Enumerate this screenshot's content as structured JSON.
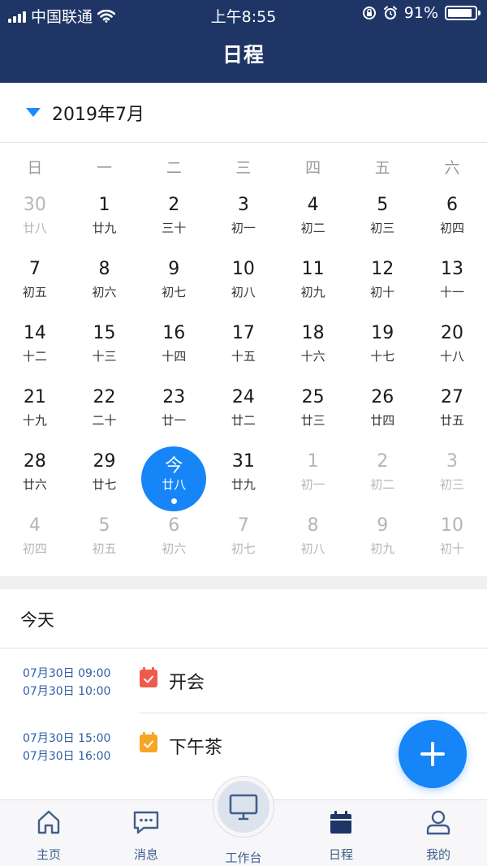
{
  "status_bar": {
    "carrier": "中国联通",
    "time": "上午8:55",
    "battery": "91%",
    "battery_level": 0.91
  },
  "header": {
    "title": "日程"
  },
  "month_selector": {
    "label": "2019年7月"
  },
  "calendar": {
    "weekdays": [
      "日",
      "一",
      "二",
      "三",
      "四",
      "五",
      "六"
    ],
    "weeks": [
      [
        {
          "day": "30",
          "lunar": "廿八",
          "dim": true
        },
        {
          "day": "1",
          "lunar": "廿九"
        },
        {
          "day": "2",
          "lunar": "三十"
        },
        {
          "day": "3",
          "lunar": "初一"
        },
        {
          "day": "4",
          "lunar": "初二"
        },
        {
          "day": "5",
          "lunar": "初三"
        },
        {
          "day": "6",
          "lunar": "初四"
        }
      ],
      [
        {
          "day": "7",
          "lunar": "初五"
        },
        {
          "day": "8",
          "lunar": "初六"
        },
        {
          "day": "9",
          "lunar": "初七"
        },
        {
          "day": "10",
          "lunar": "初八"
        },
        {
          "day": "11",
          "lunar": "初九"
        },
        {
          "day": "12",
          "lunar": "初十"
        },
        {
          "day": "13",
          "lunar": "十一"
        }
      ],
      [
        {
          "day": "14",
          "lunar": "十二"
        },
        {
          "day": "15",
          "lunar": "十三"
        },
        {
          "day": "16",
          "lunar": "十四"
        },
        {
          "day": "17",
          "lunar": "十五"
        },
        {
          "day": "18",
          "lunar": "十六"
        },
        {
          "day": "19",
          "lunar": "十七"
        },
        {
          "day": "20",
          "lunar": "十八"
        }
      ],
      [
        {
          "day": "21",
          "lunar": "十九"
        },
        {
          "day": "22",
          "lunar": "二十"
        },
        {
          "day": "23",
          "lunar": "廿一"
        },
        {
          "day": "24",
          "lunar": "廿二"
        },
        {
          "day": "25",
          "lunar": "廿三"
        },
        {
          "day": "26",
          "lunar": "廿四"
        },
        {
          "day": "27",
          "lunar": "廿五"
        }
      ],
      [
        {
          "day": "28",
          "lunar": "廿六"
        },
        {
          "day": "29",
          "lunar": "廿七"
        },
        {
          "day": "今",
          "lunar": "廿八",
          "today": true
        },
        {
          "day": "31",
          "lunar": "廿九"
        },
        {
          "day": "1",
          "lunar": "初一",
          "dim": true
        },
        {
          "day": "2",
          "lunar": "初二",
          "dim": true
        },
        {
          "day": "3",
          "lunar": "初三",
          "dim": true
        }
      ],
      [
        {
          "day": "4",
          "lunar": "初四",
          "dim": true
        },
        {
          "day": "5",
          "lunar": "初五",
          "dim": true
        },
        {
          "day": "6",
          "lunar": "初六",
          "dim": true
        },
        {
          "day": "7",
          "lunar": "初七",
          "dim": true
        },
        {
          "day": "8",
          "lunar": "初八",
          "dim": true
        },
        {
          "day": "9",
          "lunar": "初九",
          "dim": true
        },
        {
          "day": "10",
          "lunar": "初十",
          "dim": true
        }
      ]
    ]
  },
  "today_section": {
    "title": "今天",
    "events": [
      {
        "start": "07月30日 09:00",
        "end": "07月30日 10:00",
        "title": "开会",
        "color": "#ef5a4f"
      },
      {
        "start": "07月30日 15:00",
        "end": "07月30日 16:00",
        "title": "下午茶",
        "color": "#f5a623"
      }
    ]
  },
  "tabbar": {
    "tabs": [
      {
        "label": "主页",
        "icon": "home-icon"
      },
      {
        "label": "消息",
        "icon": "message-icon"
      },
      {
        "label": "工作台",
        "icon": "monitor-icon"
      },
      {
        "label": "日程",
        "icon": "calendar-icon",
        "active": true
      },
      {
        "label": "我的",
        "icon": "user-icon"
      }
    ]
  },
  "colors": {
    "header_bg": "#1f3566",
    "accent": "#1685f8",
    "event_time": "#2d5fa8"
  }
}
